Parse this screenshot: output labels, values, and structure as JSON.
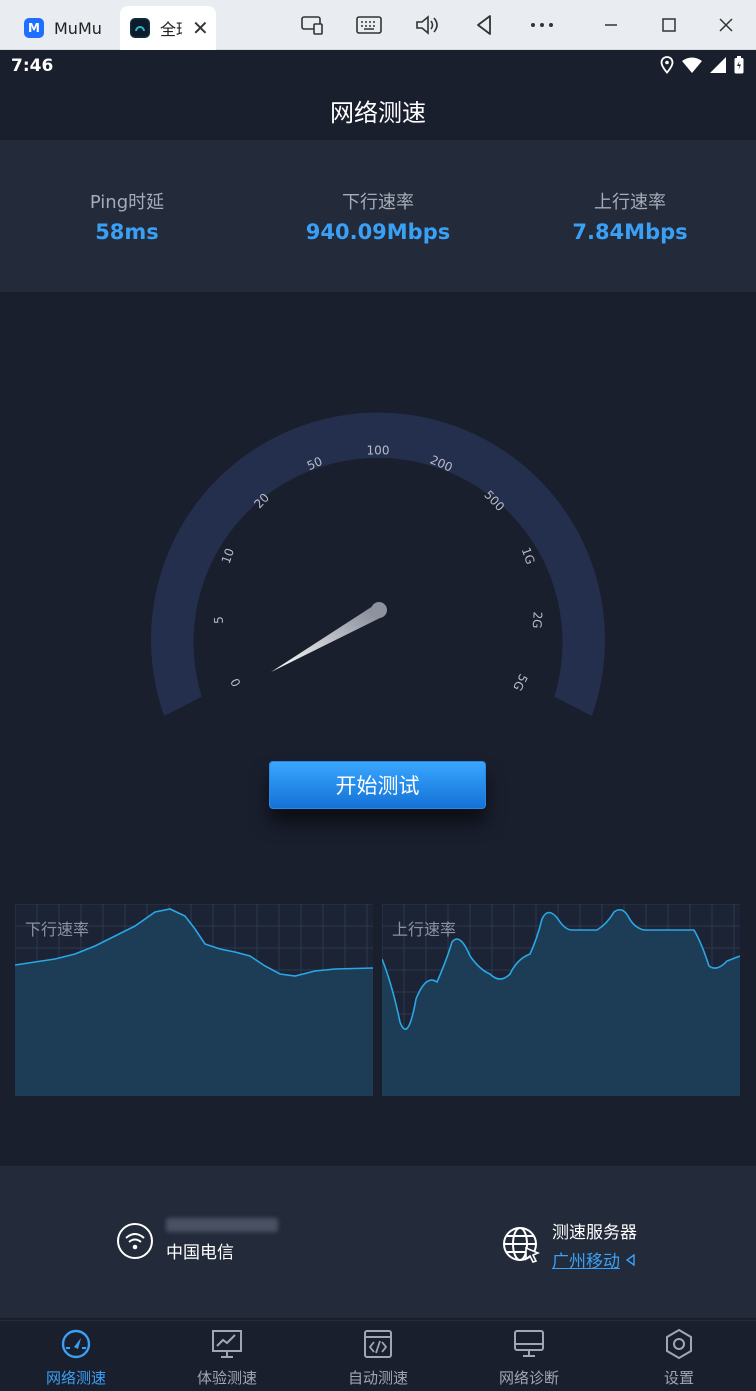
{
  "emulator": {
    "tabs": [
      {
        "label": "MuMu"
      },
      {
        "label": "全球网测"
      }
    ]
  },
  "status": {
    "time": "7:46"
  },
  "header": {
    "title": "网络测速"
  },
  "stats": {
    "ping": {
      "label": "Ping时延",
      "value": "58ms"
    },
    "download": {
      "label": "下行速率",
      "value": "940.09Mbps"
    },
    "upload": {
      "label": "上行速率",
      "value": "7.84Mbps"
    }
  },
  "gauge": {
    "scale_labels": [
      "0",
      "5",
      "10",
      "20",
      "50",
      "100",
      "200",
      "500",
      "1G",
      "2G",
      "5G"
    ],
    "needle_value": "5",
    "colors": {
      "track": "#242f4d",
      "background": "#1a1f2e"
    }
  },
  "start_button": {
    "label": "开始测试"
  },
  "charts": {
    "download": {
      "label": "下行速率"
    },
    "upload": {
      "label": "上行速率"
    },
    "colors": {
      "line": "#29a7e6",
      "fill": "#1d3d57",
      "grid": "#2b3a4f"
    }
  },
  "network": {
    "carrier": "中国电信"
  },
  "server": {
    "title": "测速服务器",
    "name": "广州移动"
  },
  "nav": {
    "items": [
      {
        "label": "网络测速",
        "icon": "speedometer-icon"
      },
      {
        "label": "体验测速",
        "icon": "experience-chart-icon"
      },
      {
        "label": "自动测速",
        "icon": "code-icon"
      },
      {
        "label": "网络诊断",
        "icon": "monitor-icon"
      },
      {
        "label": "设置",
        "icon": "hexagon-settings-icon"
      }
    ]
  }
}
